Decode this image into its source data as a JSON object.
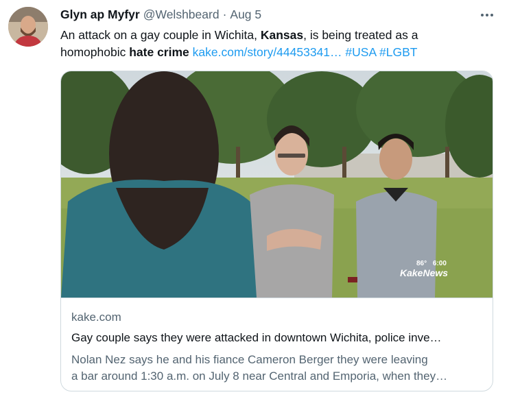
{
  "author": {
    "display_name": "Glyn ap Myfyr",
    "handle": "@Welshbeard",
    "separator": "·",
    "date": "Aug 5"
  },
  "tweet": {
    "text_1": "An attack on a gay couple in Wichita, ",
    "bold_1": "Kansas",
    "text_2": ", is being treated as a homophobic ",
    "bold_2": "hate crime",
    "link": "kake.com/story/44453341…",
    "hashtag_1": "#USA",
    "hashtag_2": "#LGBT"
  },
  "card": {
    "domain": "kake.com",
    "title": "Gay couple says they were attacked in downtown Wichita, police inve…",
    "description_line_1": "Nolan Nez says he and his fiance Cameron Berger they were leaving",
    "description_line_2": "a bar around 1:30 a.m. on July 8 near Central and Emporia, when they…",
    "overlay_temp": "86°",
    "overlay_time": "6:00",
    "overlay_brand": "KakeNews"
  },
  "icons": {
    "more": "more-horizontal-icon",
    "avatar": "user-avatar"
  },
  "colors": {
    "link": "#1d9bf0",
    "secondary": "#536471",
    "border": "#cfd9de"
  }
}
